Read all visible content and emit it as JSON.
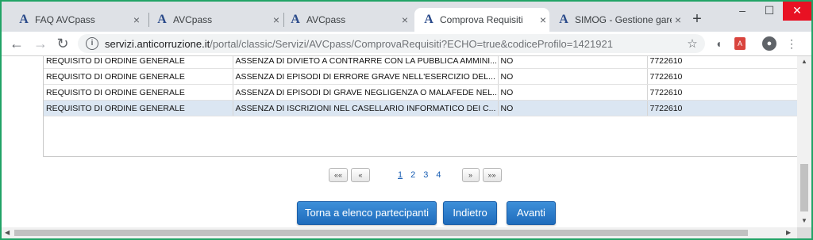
{
  "browser": {
    "tabs": [
      {
        "label": "FAQ AVCpass",
        "active": false
      },
      {
        "label": "AVCpass",
        "active": false
      },
      {
        "label": "AVCpass",
        "active": false
      },
      {
        "label": "Comprova Requisiti",
        "active": true
      },
      {
        "label": "SIMOG - Gestione gare",
        "active": false
      }
    ],
    "tab_favicon": "A",
    "tab_close": "×",
    "new_tab": "+",
    "window": {
      "minimize": "–",
      "maximize": "☐",
      "close": "✕"
    },
    "url_host": "servizi.anticorruzione.it",
    "url_path": "/portal/classic/Servizi/AVCpass/ComprovaRequisiti?ECHO=true&codiceProfilo=1421921",
    "star": "☆",
    "icons": [
      "back-arrow-icon",
      "forward-arrow-icon",
      "reload-icon",
      "info-icon",
      "star-icon",
      "extension-icon",
      "pdf-icon",
      "profile-icon",
      "menu-icon"
    ]
  },
  "table": {
    "rows": [
      {
        "c1": "REQUISITO DI ORDINE GENERALE",
        "c2": "ASSENZA DI DIVIETO A CONTRARRE CON LA PUBBLICA AMMINI...",
        "c3": "NO",
        "c4": "",
        "c5": "7722610",
        "selected": false
      },
      {
        "c1": "REQUISITO DI ORDINE GENERALE",
        "c2": "ASSENZA DI EPISODI DI ERRORE GRAVE NELL'ESERCIZIO DEL...",
        "c3": "NO",
        "c4": "",
        "c5": "7722610",
        "selected": false
      },
      {
        "c1": "REQUISITO DI ORDINE GENERALE",
        "c2": "ASSENZA DI EPISODI DI GRAVE NEGLIGENZA O MALAFEDE NEL...",
        "c3": "NO",
        "c4": "",
        "c5": "7722610",
        "selected": false
      },
      {
        "c1": "REQUISITO DI ORDINE GENERALE",
        "c2": "ASSENZA DI ISCRIZIONI NEL CASELLARIO INFORMATICO DEI C...",
        "c3": "NO",
        "c4": "",
        "c5": "7722610",
        "selected": true
      }
    ]
  },
  "pager": {
    "first": "««",
    "prev": "«",
    "pages": [
      "1",
      "2",
      "3",
      "4"
    ],
    "current": "1",
    "next": "»",
    "last": "»»"
  },
  "buttons": {
    "back_to_list": "Torna a elenco partecipanti",
    "back": "Indietro",
    "next": "Avanti"
  },
  "colors": {
    "window_border": "#21a366",
    "selected_row": "#dbe6f2",
    "button": "#1f6cbc",
    "link": "#1a5fb4"
  }
}
